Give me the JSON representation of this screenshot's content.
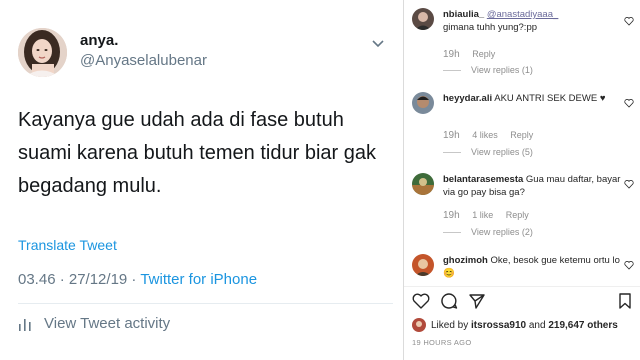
{
  "tweet": {
    "name": "anya.",
    "handle": "@Anyaselalubenar",
    "text": "Kayanya gue udah ada di fase butuh suami karena butuh temen tidur biar gak begadang mulu.",
    "translate_label": "Translate Tweet",
    "datetime": "03.46 · 27/12/19 · ",
    "source": "Twitter for iPhone",
    "activity_label": "View Tweet activity"
  },
  "instagram": {
    "comments": [
      {
        "user": "nbiaulia_",
        "mention": "@anastadiyaaa_",
        "text": "gimana tuhh yung?:pp",
        "time": "19h",
        "likes": "",
        "reply_label": "Reply",
        "view_replies": "View replies (1)"
      },
      {
        "user": "heyydar.ali",
        "text": "AKU ANTRI SEK DEWE ♥",
        "time": "19h",
        "likes": "4 likes",
        "reply_label": "Reply",
        "view_replies": "View replies (5)"
      },
      {
        "user": "belantarasemesta",
        "text": "Gua mau daftar, bayar via go pay bisa ga?",
        "time": "19h",
        "likes": "1 like",
        "reply_label": "Reply",
        "view_replies": "View replies (2)"
      },
      {
        "user": "ghozimoh",
        "text": "Oke, besok gue ketemu ortu lo 😊",
        "time": "",
        "likes": "",
        "reply_label": "",
        "view_replies": ""
      }
    ],
    "liked_by_prefix": "Liked by ",
    "liked_by_user": "itsrossa910",
    "liked_by_and": " and ",
    "liked_by_count": "219,647 others",
    "timestamp": "19 HOURS AGO"
  },
  "icons": {
    "tweet_menu": "chevron-down-icon",
    "activity": "bar-chart-icon",
    "like": "heart-icon",
    "comment": "comment-icon",
    "share": "paper-plane-icon",
    "save": "bookmark-icon"
  },
  "colors": {
    "twitter_blue": "#1b95e0",
    "twitter_gray": "#657786",
    "ig_gray": "#8e8e8e"
  }
}
